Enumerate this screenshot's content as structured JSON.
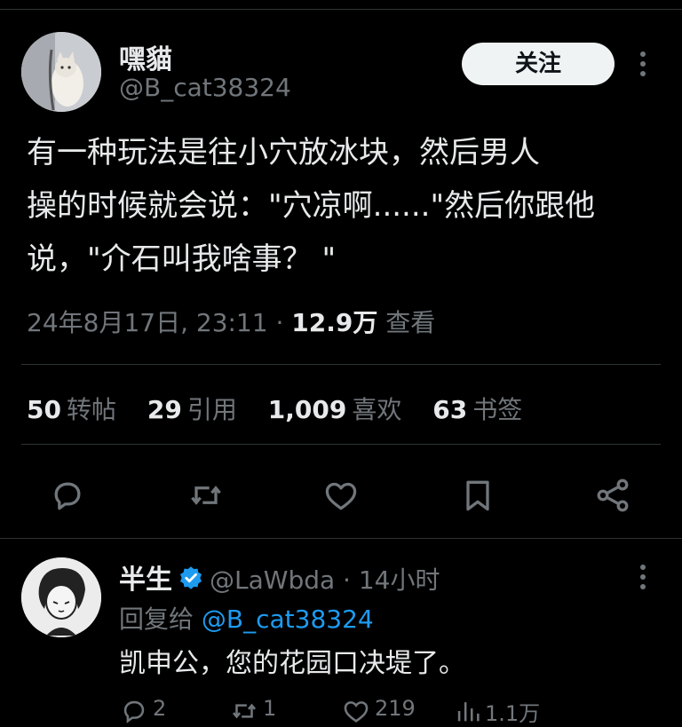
{
  "tweet": {
    "display_name": "嘿貓",
    "handle": "@B_cat38324",
    "follow_label": "关注",
    "text_lines": [
      "有一种玩法是往小穴放冰块，然后男人",
      "操的时候就会说：\"穴凉啊......\"然后你跟他",
      "说，\"介石叫我啥事？ \""
    ],
    "timestamp": "24年8月17日, 23:11 · ",
    "views_count": "12.9万",
    "views_label": " 查看",
    "stats": {
      "retweets_num": "50",
      "retweets_label": "转帖",
      "quotes_num": "29",
      "quotes_label": "引用",
      "likes_num": "1,009",
      "likes_label": "喜欢",
      "bookmarks_num": "63",
      "bookmarks_label": "书签"
    }
  },
  "reply": {
    "display_name": "半生",
    "handle": "@LaWbda",
    "time": " · 14小时",
    "reply_to_label": "回复给 ",
    "reply_to_handle": "@B_cat38324",
    "text": "凯申公，您的花园口决堤了。",
    "counts": {
      "replies": "2",
      "retweets": "1",
      "likes": "219",
      "views": "1.1万"
    }
  },
  "colors": {
    "background": "#000000",
    "text": "#e7e9ea",
    "muted": "#71767b",
    "accent": "#1d9bf0"
  },
  "icons": [
    "reply-icon",
    "retweet-icon",
    "like-icon",
    "bookmark-icon",
    "share-icon",
    "verified-badge-icon",
    "more-icon"
  ]
}
